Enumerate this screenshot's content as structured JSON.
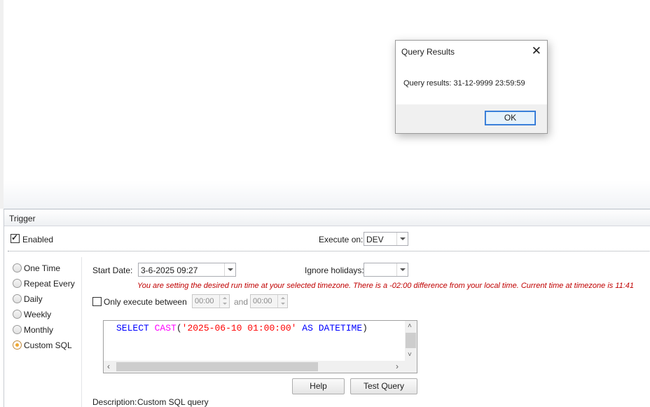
{
  "dialog": {
    "title": "Query Results",
    "close_glyph": "✕",
    "message": "Query results: 31-12-9999 23:59:59",
    "ok_label": "OK"
  },
  "trigger": {
    "header": "Trigger",
    "enabled_label": "Enabled",
    "enabled_checked": true,
    "execute_on_label": "Execute on:",
    "execute_on_value": "DEV",
    "schedule_options": [
      {
        "label": "One Time",
        "selected": false
      },
      {
        "label": "Repeat Every",
        "selected": false
      },
      {
        "label": "Daily",
        "selected": false
      },
      {
        "label": "Weekly",
        "selected": false
      },
      {
        "label": "Monthly",
        "selected": false
      },
      {
        "label": "Custom SQL",
        "selected": true
      }
    ],
    "start_date_label": "Start Date:",
    "start_date_value": "3-6-2025 09:27",
    "ignore_holidays_label": "Ignore holidays:",
    "ignore_holidays_value": "",
    "timezone_warning": "You are setting the desired run time at your selected timezone. There is a -02:00 difference from your local time. Current time at timezone is 11:41",
    "only_execute_label": "Only execute between",
    "only_execute_checked": false,
    "time_from": "00:00",
    "and_label": "and",
    "time_to": "00:00",
    "sql": {
      "kw1": "SELECT",
      "fn": "CAST",
      "paren_open": "(",
      "literal": "'2025-06-10 01:00:00'",
      "kw2": "AS",
      "kw3": "DATETIME",
      "paren_close": ")"
    },
    "help_label": "Help",
    "test_query_label": "Test Query",
    "description_label": "Description:",
    "description_value": "Custom SQL query"
  },
  "colors": {
    "warning": "#c00000",
    "sql_keyword": "#0000ff",
    "sql_function": "#ff00ff",
    "sql_string": "#ff0000",
    "radio_selected": "#f0a830"
  },
  "icons": {
    "close": "close-icon",
    "dropdown": "chevron-down-icon",
    "scroll_up": "arrow-up-icon",
    "scroll_down": "arrow-down-icon",
    "scroll_left": "arrow-left-icon",
    "scroll_right": "arrow-right-icon"
  }
}
